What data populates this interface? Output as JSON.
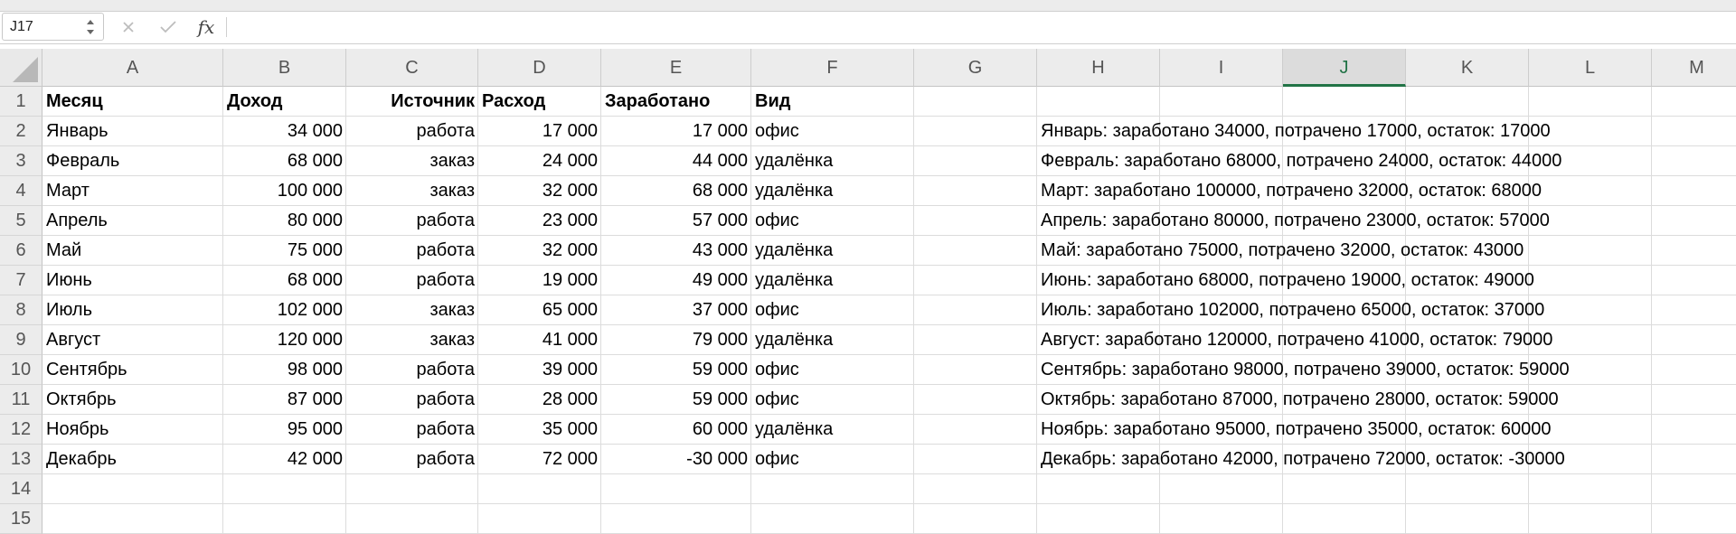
{
  "formula_bar": {
    "name_box": "J17",
    "fx_label": "fx",
    "formula_value": ""
  },
  "columns": [
    "A",
    "B",
    "C",
    "D",
    "E",
    "F",
    "G",
    "H",
    "I",
    "J",
    "K",
    "L",
    "M"
  ],
  "active_column": "J",
  "rows": [
    "1",
    "2",
    "3",
    "4",
    "5",
    "6",
    "7",
    "8",
    "9",
    "10",
    "11",
    "12",
    "13",
    "14",
    "15"
  ],
  "header_row": [
    "Месяц",
    "Доход",
    "Источник",
    "Расход",
    "Заработано",
    "Вид"
  ],
  "data_rows": [
    {
      "month": "Январь",
      "income": "34 000",
      "source": "работа",
      "expense": "17 000",
      "earned": "17 000",
      "kind": "офис",
      "summary": "Январь: заработано 34000, потрачено 17000, остаток: 17000"
    },
    {
      "month": "Февраль",
      "income": "68 000",
      "source": "заказ",
      "expense": "24 000",
      "earned": "44 000",
      "kind": "удалёнка",
      "summary": "Февраль: заработано 68000, потрачено 24000, остаток: 44000"
    },
    {
      "month": "Март",
      "income": "100 000",
      "source": "заказ",
      "expense": "32 000",
      "earned": "68 000",
      "kind": "удалёнка",
      "summary": "Март: заработано 100000, потрачено 32000, остаток: 68000"
    },
    {
      "month": "Апрель",
      "income": "80 000",
      "source": "работа",
      "expense": "23 000",
      "earned": "57 000",
      "kind": "офис",
      "summary": "Апрель: заработано 80000, потрачено 23000, остаток: 57000"
    },
    {
      "month": "Май",
      "income": "75 000",
      "source": "работа",
      "expense": "32 000",
      "earned": "43 000",
      "kind": "удалёнка",
      "summary": "Май: заработано 75000, потрачено 32000, остаток: 43000"
    },
    {
      "month": "Июнь",
      "income": "68 000",
      "source": "работа",
      "expense": "19 000",
      "earned": "49 000",
      "kind": "удалёнка",
      "summary": "Июнь: заработано 68000, потрачено 19000, остаток: 49000"
    },
    {
      "month": "Июль",
      "income": "102 000",
      "source": "заказ",
      "expense": "65 000",
      "earned": "37 000",
      "kind": "офис",
      "summary": "Июль: заработано 102000, потрачено 65000, остаток: 37000"
    },
    {
      "month": "Август",
      "income": "120 000",
      "source": "заказ",
      "expense": "41 000",
      "earned": "79 000",
      "kind": "удалёнка",
      "summary": "Август: заработано 120000, потрачено 41000, остаток: 79000"
    },
    {
      "month": "Сентябрь",
      "income": "98 000",
      "source": "работа",
      "expense": "39 000",
      "earned": "59 000",
      "kind": "офис",
      "summary": "Сентябрь: заработано 98000, потрачено 39000, остаток: 59000"
    },
    {
      "month": "Октябрь",
      "income": "87 000",
      "source": "работа",
      "expense": "28 000",
      "earned": "59 000",
      "kind": "офис",
      "summary": "Октябрь: заработано 87000, потрачено 28000, остаток: 59000"
    },
    {
      "month": "Ноябрь",
      "income": "95 000",
      "source": "работа",
      "expense": "35 000",
      "earned": "60 000",
      "kind": "удалёнка",
      "summary": "Ноябрь: заработано 95000, потрачено 35000, остаток: 60000"
    },
    {
      "month": "Декабрь",
      "income": "42 000",
      "source": "работа",
      "expense": "72 000",
      "earned": "-30 000",
      "kind": "офис",
      "summary": "Декабрь: заработано 42000, потрачено 72000, остаток: -30000"
    }
  ],
  "colors": {
    "accent": "#217346"
  }
}
